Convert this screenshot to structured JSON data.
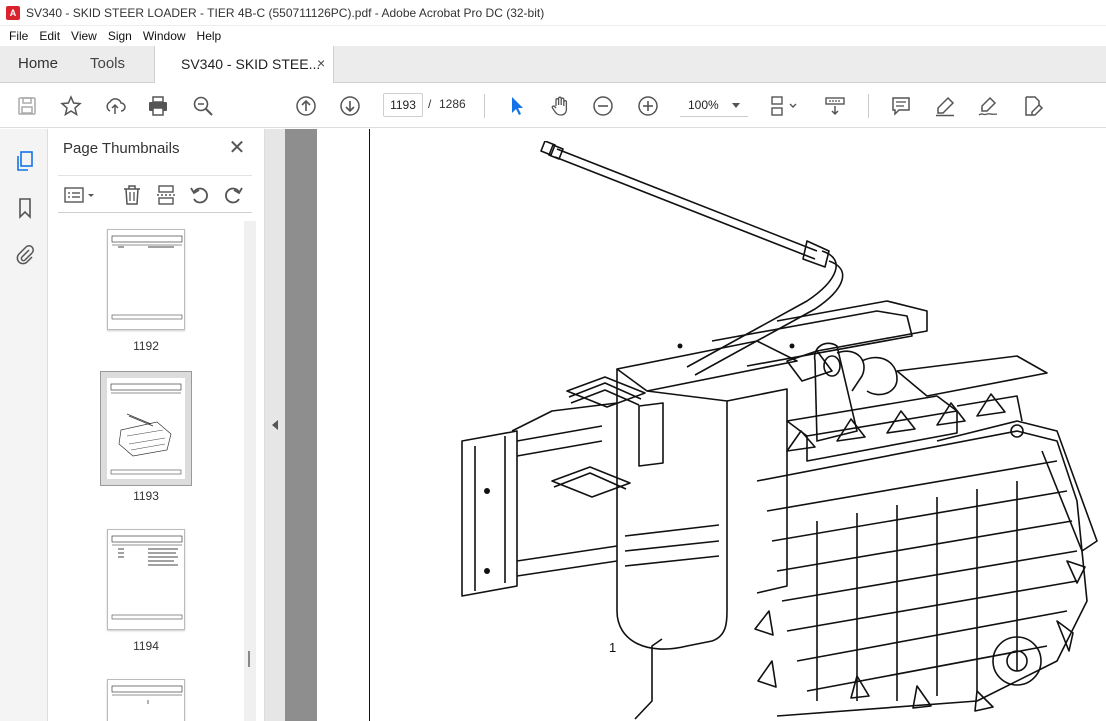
{
  "window": {
    "title": "SV340 - SKID STEER LOADER - TIER 4B-C (550711126PC).pdf - Adobe Acrobat Pro DC (32-bit)",
    "app_icon": "acrobat-icon"
  },
  "menu": [
    "File",
    "Edit",
    "View",
    "Sign",
    "Window",
    "Help"
  ],
  "tabs": {
    "home": "Home",
    "tools": "Tools",
    "document": "SV340 - SKID STEE...",
    "close": "×"
  },
  "toolbar": {
    "page_current": "1193",
    "page_separator": "/",
    "page_total": "1286",
    "zoom": "100%",
    "icons": [
      "save-icon",
      "star-icon",
      "upload-icon",
      "print-icon",
      "search-zoom-icon",
      "prev-page-icon",
      "next-page-icon",
      "select-arrow-icon",
      "hand-icon",
      "zoom-out-icon",
      "zoom-in-icon",
      "page-fit-icon",
      "scroll-mode-icon",
      "comment-icon",
      "highlight-icon",
      "sign-icon",
      "edit-pdf-icon"
    ],
    "accent": "#1473e6"
  },
  "leftrail": {
    "icons": [
      "page-thumbnails-icon",
      "bookmark-icon",
      "attachment-icon"
    ]
  },
  "thumbnails": {
    "title": "Page Thumbnails",
    "close": "✕",
    "pages": [
      {
        "number": "1192",
        "selected": false
      },
      {
        "number": "1193",
        "selected": true
      },
      {
        "number": "1194",
        "selected": false
      }
    ]
  },
  "document": {
    "callout_label": "1"
  }
}
